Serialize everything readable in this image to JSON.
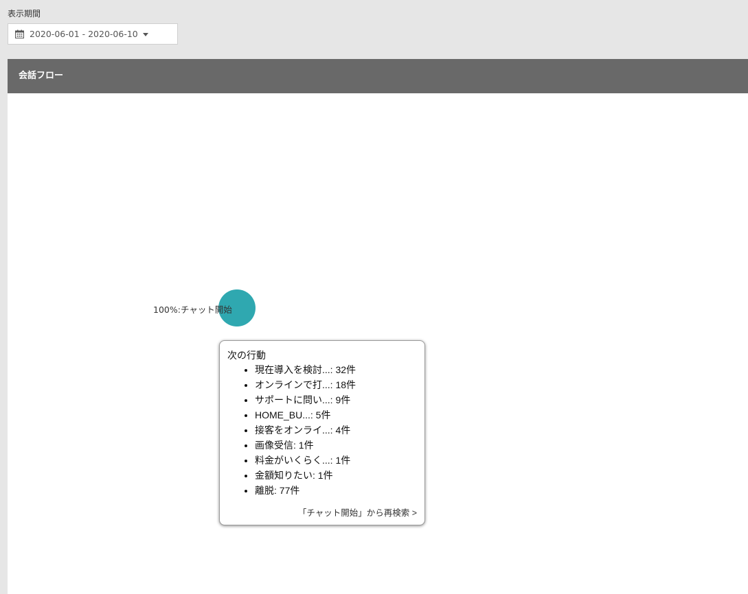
{
  "filter": {
    "label": "表示期間",
    "date_range": "2020-06-01 - 2020-06-10"
  },
  "panel": {
    "title": "会話フロー"
  },
  "flow": {
    "node": {
      "label": "100%:チャット開始",
      "color": "#2fa8b0"
    },
    "tooltip": {
      "title": "次の行動",
      "items": [
        "現在導入を検討...: 32件",
        "オンラインで打...: 18件",
        "サポートに問い...: 9件",
        "HOME_BU...: 5件",
        "接客をオンライ...: 4件",
        "画像受信: 1件",
        "料金がいくらく...: 1件",
        "金額知りたい: 1件",
        "離脱: 77件"
      ],
      "research_link": "「チャット開始」から再検索 >"
    }
  },
  "colors": {
    "header_bg": "#696969",
    "page_bg": "#e6e6e6",
    "node": "#2fa8b0"
  }
}
